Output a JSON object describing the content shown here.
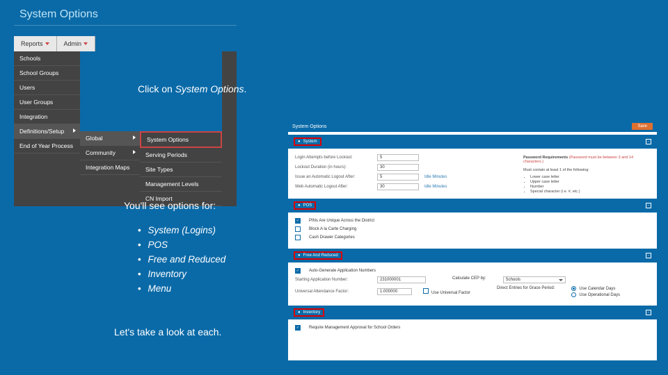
{
  "title": "System Options",
  "instructions": {
    "click_on": "Click on ",
    "click_target": "System Options",
    "period": ".",
    "see_options": "You'll see options for:",
    "look_each": "Let's take a look at each."
  },
  "bullets": [
    "System (Logins)",
    "POS",
    "Free and Reduced",
    "Inventory",
    "Menu"
  ],
  "nav": {
    "tabs": [
      "Reports",
      "Admin"
    ],
    "col1": [
      "Schools",
      "School Groups",
      "Users",
      "User Groups",
      "Integration",
      "Definitions/Setup",
      "End of Year Process"
    ],
    "col2": [
      "Global",
      "Community",
      "Integration Maps"
    ],
    "col3": [
      "System Options",
      "Serving Periods",
      "Site Types",
      "Management Levels",
      "CN Import"
    ]
  },
  "panel": {
    "header": "System Options",
    "save": "Save",
    "sections": {
      "system": {
        "title": "System",
        "rows": [
          {
            "label": "Login Attempts before Lockout:",
            "value": "5"
          },
          {
            "label": "Lockout Duration (in hours):",
            "value": "30"
          },
          {
            "label": "Issue an Automatic Logout After:",
            "value": "5",
            "link": "Idle Minutes"
          },
          {
            "label": "Web Automatic Logout After:",
            "value": "30",
            "link": "Idle Minutes"
          }
        ],
        "pw_header": "Password Requirements",
        "pw_note": "(Password must be between 3 and 14 characters.)",
        "pw_items_header": "Must contain at least 1 of the following:",
        "pw_items": [
          "Lower case letter",
          "Upper case letter",
          "Number",
          "Special character (i.e. #, etc.)"
        ]
      },
      "pos": {
        "title": "POS",
        "rows": [
          "PINs Are Unique Across the District",
          "Block A la Carte Charging",
          "Cash Drawer Categories"
        ]
      },
      "far": {
        "title": "Free And Reduced",
        "auto_gen": "Auto-Generate Application Numbers",
        "starting_label": "Starting Application Number:",
        "starting_value": "231000001",
        "factor_label": "Universal Attendance Factor:",
        "factor_value": "1.000000",
        "use_universal": "Use Universal Factor",
        "calc_label": "Calculate CEP by:",
        "calc_value": "Schools",
        "grace_label": "Direct Entries for Grace Period:",
        "grace_opts": [
          "Use Calendar Days",
          "Use Operational Days"
        ]
      },
      "inventory": {
        "title": "Inventory",
        "row": "Require Management Approval for School Orders"
      }
    }
  }
}
